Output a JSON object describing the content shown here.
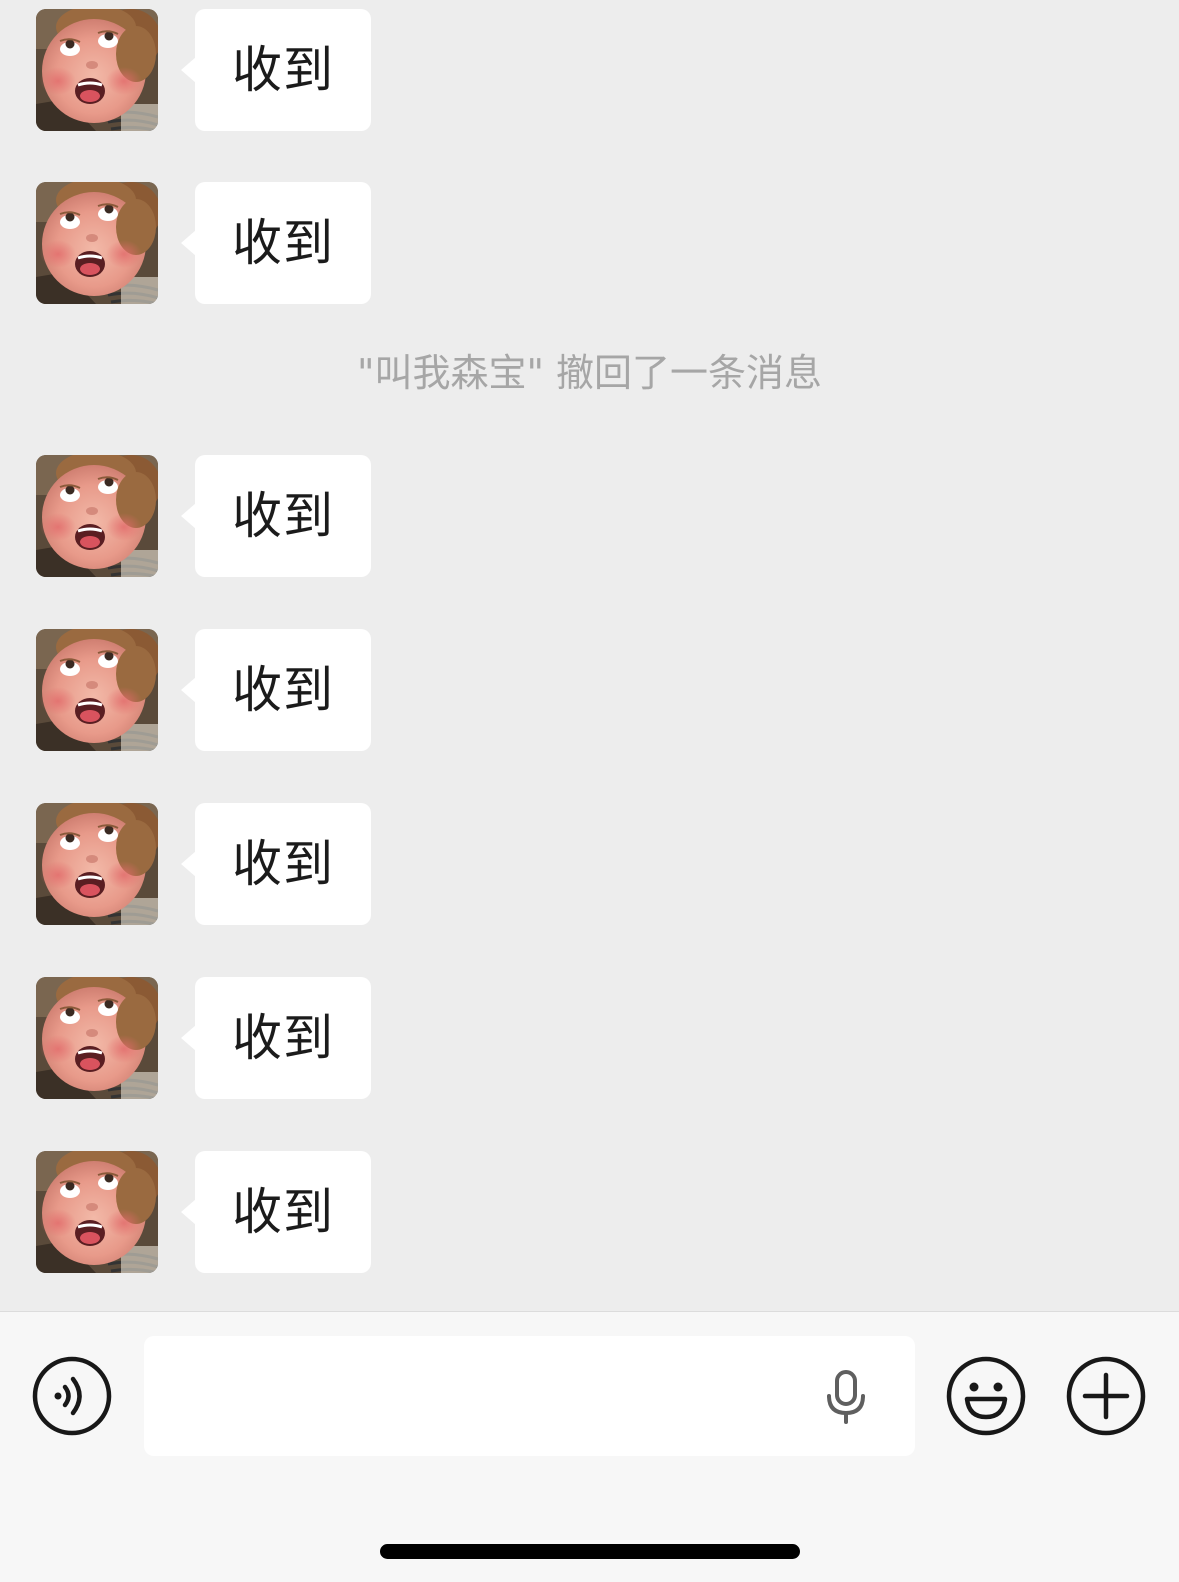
{
  "chat": {
    "messages_before_recall": [
      {
        "sender": "avatar-kid",
        "text": "收到"
      },
      {
        "sender": "avatar-kid",
        "text": "收到"
      }
    ],
    "recall_notice": "\"叫我森宝\" 撤回了一条消息",
    "messages_after_recall": [
      {
        "sender": "avatar-kid",
        "text": "收到"
      },
      {
        "sender": "avatar-kid",
        "text": "收到"
      },
      {
        "sender": "avatar-kid",
        "text": "收到"
      },
      {
        "sender": "avatar-kid",
        "text": "收到"
      },
      {
        "sender": "avatar-kid",
        "text": "收到"
      }
    ]
  },
  "input_bar": {
    "voice_icon": "voice-mode-icon",
    "input_value": "",
    "mic_icon": "microphone-icon",
    "emoji_icon": "smiley-icon",
    "plus_icon": "plus-icon"
  },
  "colors": {
    "chat_background": "#ededed",
    "bubble": "#ffffff",
    "input_bar": "#f7f7f7",
    "recall_text": "#a6a6a6"
  }
}
